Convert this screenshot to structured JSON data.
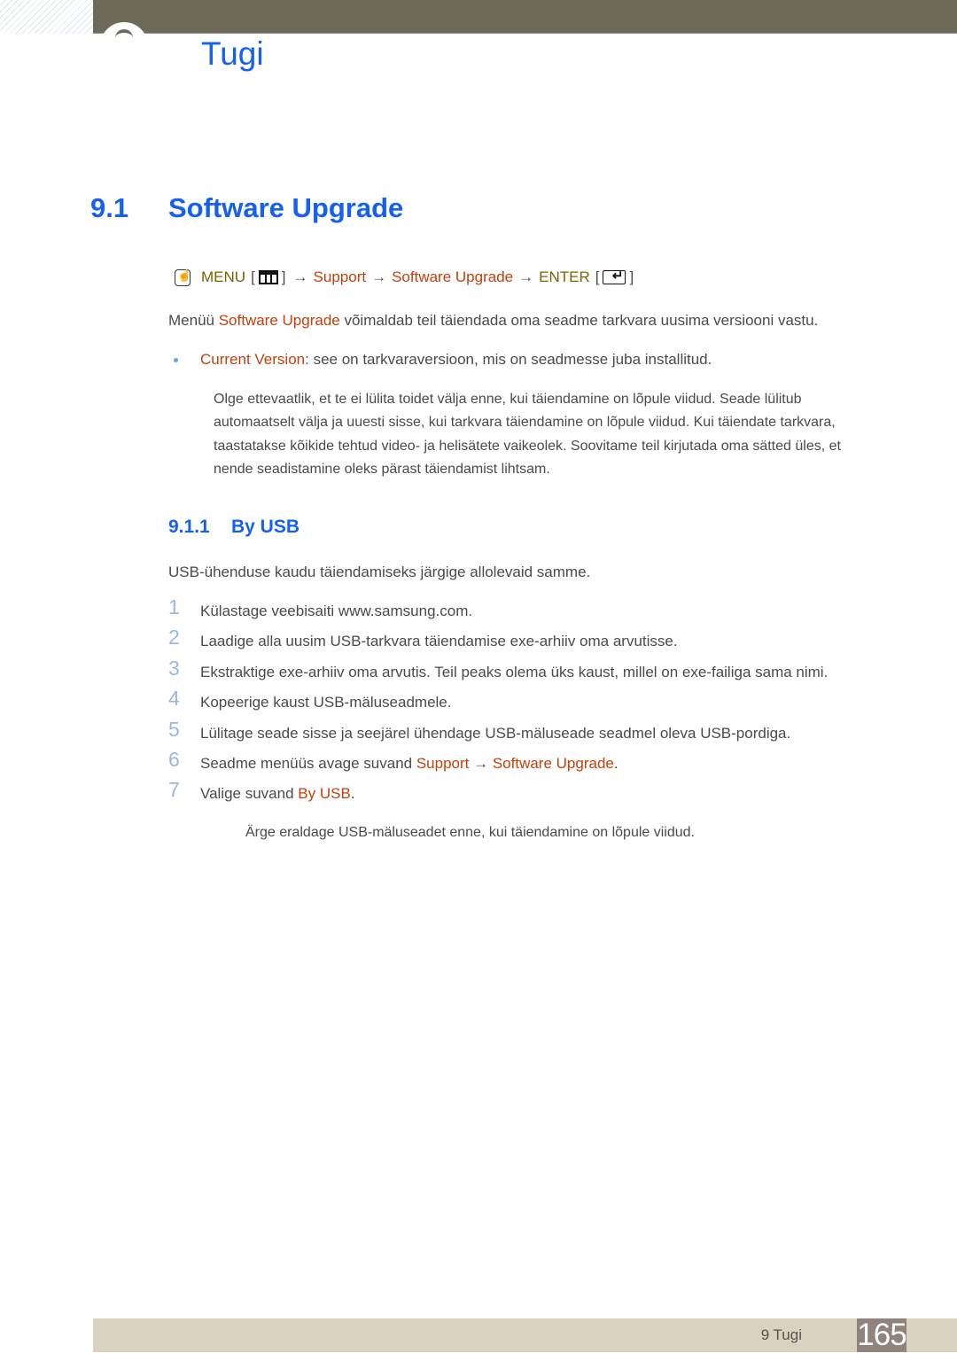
{
  "header": {
    "chapter_title": "Tugi"
  },
  "section": {
    "number": "9.1",
    "title": "Software Upgrade"
  },
  "menu_path": {
    "menu_label": "MENU",
    "arrow": "→",
    "support": "Support",
    "software_upgrade": "Software Upgrade",
    "enter_label": "ENTER",
    "open_bracket": "[",
    "close_bracket": "]",
    "icons": [
      "hand-remote-icon",
      "menu-grid-icon",
      "enter-key-icon"
    ]
  },
  "intro": {
    "prefix": "Menüü ",
    "highlight": "Software Upgrade",
    "suffix": " võimaldab teil täiendada oma seadme tarkvara uusima versiooni vastu."
  },
  "bullet": {
    "label": "Current Version",
    "text": ": see on tarkvaraversioon, mis on seadmesse juba installitud."
  },
  "note": "Olge ettevaatlik, et te ei lülita toidet välja enne, kui täiendamine on lõpule viidud. Seade lülitub automaatselt välja ja uuesti sisse, kui tarkvara täiendamine on lõpule viidud. Kui täiendate tarkvara, taastatakse kõikide tehtud video- ja helisätete vaikeolek. Soovitame teil kirjutada oma sätted üles, et nende seadistamine oleks pärast täiendamist lihtsam.",
  "subsection": {
    "number": "9.1.1",
    "title": "By USB",
    "intro": "USB-ühenduse kaudu täiendamiseks järgige allolevaid samme."
  },
  "steps": [
    {
      "n": "1",
      "text": "Külastage veebisaiti www.samsung.com."
    },
    {
      "n": "2",
      "text": "Laadige alla uusim USB-tarkvara täiendamise exe-arhiiv oma arvutisse."
    },
    {
      "n": "3",
      "text": "Ekstraktige exe-arhiiv oma arvutis. Teil peaks olema üks kaust, millel on exe-failiga sama nimi."
    },
    {
      "n": "4",
      "text": "Kopeerige kaust USB-mäluseadmele."
    },
    {
      "n": "5",
      "text": "Lülitage seade sisse ja seejärel ühendage USB-mäluseade seadmel oleva USB-pordiga."
    },
    {
      "n": "6",
      "prefix": "Seadme menüüs avage suvand ",
      "h1": "Support",
      "arrow": " → ",
      "h2": "Software Upgrade",
      "suffix": "."
    },
    {
      "n": "7",
      "prefix": "Valige suvand ",
      "h1": "By USB",
      "suffix": "."
    }
  ],
  "warning": "Ärge eraldage USB-mäluseadet enne, kui täiendamine on lõpule viidud.",
  "footer": {
    "chapter_label": "9 Tugi",
    "page_number": "165"
  },
  "colors": {
    "heading_blue": "#1560f0",
    "menu_olive": "#7a6400",
    "highlight_orange": "#c4400b",
    "topbar": "#6d6a59",
    "footer_bg": "#d8d2bf",
    "page_badge": "#8f837b"
  }
}
